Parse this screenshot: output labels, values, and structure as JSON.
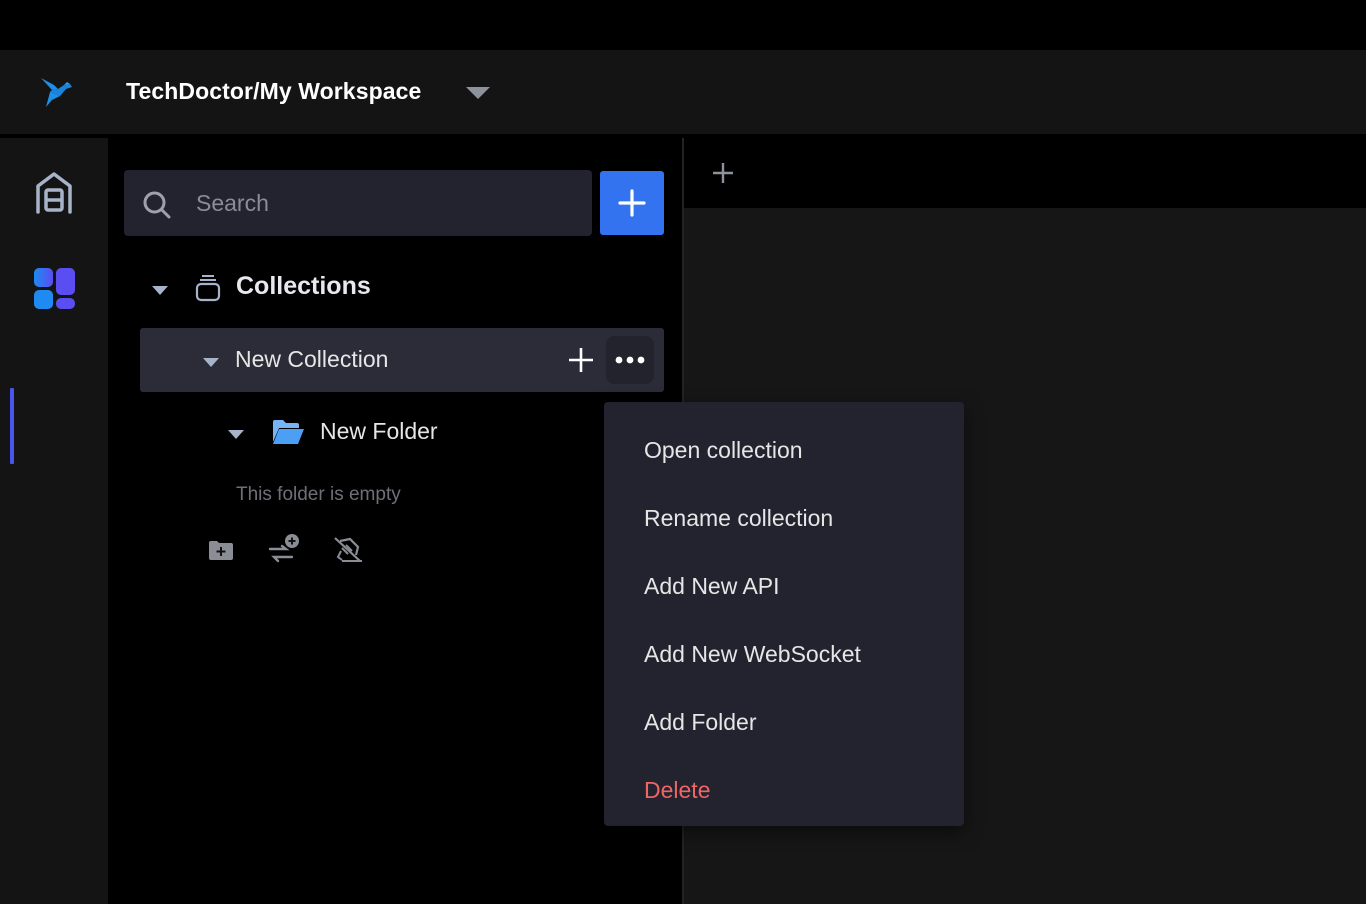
{
  "header": {
    "logo_icon": "hummingbird-logo-icon",
    "workspace_title": "TechDoctor/My Workspace",
    "workspace_dropdown_icon": "caret-down-icon"
  },
  "rail": {
    "items": [
      {
        "name": "workspace-home",
        "icon": "warehouse-icon",
        "active": false
      },
      {
        "name": "collections",
        "icon": "dashboard-icon",
        "active": true
      }
    ]
  },
  "sidebar": {
    "search": {
      "placeholder": "Search",
      "value": "",
      "icon": "search-icon"
    },
    "add_button_icon": "plus-icon",
    "section_title": "Collections",
    "section_icon": "stack-icon",
    "collections": [
      {
        "name": "New Collection",
        "expanded": true,
        "folders": [
          {
            "name": "New Folder",
            "expanded": true,
            "empty_text": "This folder is empty"
          }
        ]
      }
    ],
    "folder_actions": [
      {
        "name": "add-folder",
        "icon": "folder-plus-icon"
      },
      {
        "name": "add-request",
        "icon": "swap-plus-icon"
      },
      {
        "name": "add-websocket",
        "icon": "plug-off-icon"
      }
    ]
  },
  "tabs": {
    "new_tab_icon": "plus-icon"
  },
  "context_menu": {
    "items": [
      {
        "label": "Open collection",
        "danger": false
      },
      {
        "label": "Rename collection",
        "danger": false
      },
      {
        "label": "Add New API",
        "danger": false
      },
      {
        "label": "Add New WebSocket",
        "danger": false
      },
      {
        "label": "Add Folder",
        "danger": false
      },
      {
        "label": "Delete",
        "danger": true
      }
    ]
  },
  "colors": {
    "accent": "#3473f0",
    "active_indicator": "#4a55f0",
    "danger": "#f06464",
    "logo": "#1e8fe6"
  }
}
